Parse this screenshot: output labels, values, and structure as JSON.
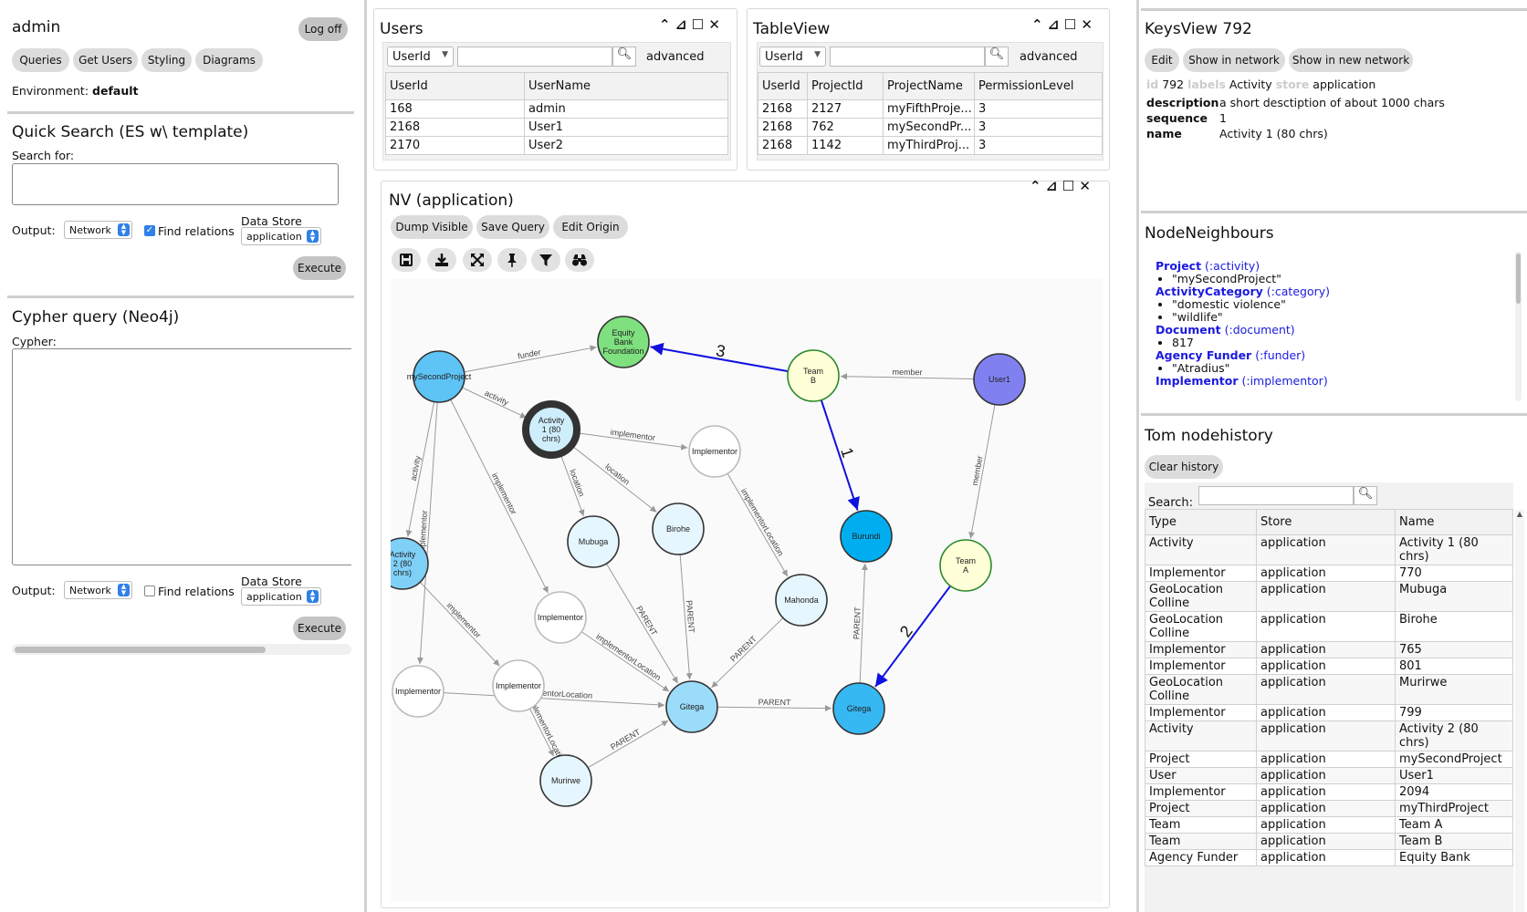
{
  "left": {
    "user": "admin",
    "logoff": "Log off",
    "nav": [
      "Queries",
      "Get Users",
      "Styling",
      "Diagrams"
    ],
    "env_label": "Environment:",
    "env_value": "default",
    "quick": {
      "title": "Quick Search (ES w\\ template)",
      "search_label": "Search for:",
      "output_label": "Output:",
      "output_value": "Network",
      "find_rel": "Find relations",
      "store_label": "Data Store",
      "store_value": "application",
      "execute": "Execute"
    },
    "cypher": {
      "title": "Cypher query (Neo4j)",
      "label": "Cypher:",
      "output_label": "Output:",
      "output_value": "Network",
      "find_rel": "Find relations",
      "store_label": "Data Store",
      "store_value": "application",
      "execute": "Execute"
    }
  },
  "users": {
    "title": "Users",
    "filter": "UserId",
    "advanced": "advanced",
    "cols": [
      "UserId",
      "UserName"
    ],
    "rows": [
      [
        "168",
        "admin"
      ],
      [
        "2168",
        "User1"
      ],
      [
        "2170",
        "User2"
      ]
    ]
  },
  "tableview": {
    "title": "TableView",
    "filter": "UserId",
    "advanced": "advanced",
    "cols": [
      "UserId",
      "ProjectId",
      "ProjectName",
      "PermissionLevel"
    ],
    "rows": [
      [
        "2168",
        "2127",
        "myFifthProje...",
        "3"
      ],
      [
        "2168",
        "762",
        "mySecondPr...",
        "3"
      ],
      [
        "2168",
        "1142",
        "myThirdProj...",
        "3"
      ]
    ]
  },
  "nv": {
    "title": "NV (application)",
    "buttons": [
      "Dump Visible",
      "Save Query",
      "Edit Origin"
    ],
    "icons": [
      "save-icon",
      "download-icon",
      "expand-icon",
      "pin-icon",
      "filter-icon",
      "binoculars-icon"
    ],
    "nodes": [
      {
        "id": "msp",
        "label": [
          "mySecondProject"
        ],
        "fill": "#5ec4f5",
        "stroke": "#333"
      },
      {
        "id": "ebf",
        "label": [
          "Equity",
          "Bank",
          "Foundation"
        ],
        "fill": "#7ee07e",
        "stroke": "#333"
      },
      {
        "id": "tb",
        "label": [
          "Team",
          "B"
        ],
        "fill": "#ffffd8",
        "stroke": "#2a8a2a"
      },
      {
        "id": "u1",
        "label": [
          "User1"
        ],
        "fill": "#8080f0",
        "stroke": "#333"
      },
      {
        "id": "a1",
        "label": [
          "Activity",
          "1 (80",
          "chrs)"
        ],
        "fill": "#cfeefc",
        "stroke": "#333"
      },
      {
        "id": "imp1",
        "label": [
          "Implementor"
        ],
        "fill": "#fff",
        "stroke": "#bbb"
      },
      {
        "id": "bur",
        "label": [
          "Burundi"
        ],
        "fill": "#00aef0",
        "stroke": "#333"
      },
      {
        "id": "mub",
        "label": [
          "Mubuga"
        ],
        "fill": "#e6f6fe",
        "stroke": "#333"
      },
      {
        "id": "bir",
        "label": [
          "Birohe"
        ],
        "fill": "#e6f6fe",
        "stroke": "#333"
      },
      {
        "id": "a2",
        "label": [
          "Activity",
          "2 (80",
          "chrs)"
        ],
        "fill": "#7fd0f7",
        "stroke": "#333"
      },
      {
        "id": "ta",
        "label": [
          "Team",
          "A"
        ],
        "fill": "#ffffd8",
        "stroke": "#2a8a2a"
      },
      {
        "id": "mah",
        "label": [
          "Mahonda"
        ],
        "fill": "#e6f6fe",
        "stroke": "#333"
      },
      {
        "id": "imp2",
        "label": [
          "Implementor"
        ],
        "fill": "#fff",
        "stroke": "#bbb"
      },
      {
        "id": "imp3",
        "label": [
          "Implementor"
        ],
        "fill": "#fff",
        "stroke": "#bbb"
      },
      {
        "id": "imp4",
        "label": [
          "Implementor"
        ],
        "fill": "#fff",
        "stroke": "#bbb"
      },
      {
        "id": "git1",
        "label": [
          "Gitega"
        ],
        "fill": "#9bdcfa",
        "stroke": "#333"
      },
      {
        "id": "git2",
        "label": [
          "Gitega"
        ],
        "fill": "#36b8f2",
        "stroke": "#333"
      },
      {
        "id": "mur",
        "label": [
          "Murirwe"
        ],
        "fill": "#e6f6fe",
        "stroke": "#333"
      }
    ],
    "edges": [
      {
        "from": "msp",
        "to": "ebf",
        "label": "funder"
      },
      {
        "from": "msp",
        "to": "a1",
        "label": "activity"
      },
      {
        "from": "msp",
        "to": "a2",
        "label": "activity"
      },
      {
        "from": "msp",
        "to": "imp2",
        "label": "implementor"
      },
      {
        "from": "msp",
        "to": "imp3",
        "label": "implementor"
      },
      {
        "from": "a1",
        "to": "imp1",
        "label": "implementor"
      },
      {
        "from": "a1",
        "to": "mub",
        "label": "location"
      },
      {
        "from": "a1",
        "to": "bir",
        "label": "location"
      },
      {
        "from": "imp1",
        "to": "mah",
        "label": "implementorLocation"
      },
      {
        "from": "u1",
        "to": "tb",
        "label": "member"
      },
      {
        "from": "u1",
        "to": "ta",
        "label": "member"
      },
      {
        "from": "tb",
        "to": "ebf",
        "label": "3",
        "blue": true
      },
      {
        "from": "tb",
        "to": "bur",
        "label": "1",
        "blue": true
      },
      {
        "from": "ta",
        "to": "git2",
        "label": "2",
        "blue": true
      },
      {
        "from": "git2",
        "to": "bur",
        "label": "PARENT"
      },
      {
        "from": "mub",
        "to": "git1",
        "label": "PARENT"
      },
      {
        "from": "bir",
        "to": "git1",
        "label": "PARENT"
      },
      {
        "from": "mah",
        "to": "git1",
        "label": "PARENT"
      },
      {
        "from": "imp2",
        "to": "git1",
        "label": "implementorLocation"
      },
      {
        "from": "imp3",
        "to": "git1",
        "label": "implementorLocation"
      },
      {
        "from": "a2",
        "to": "imp4",
        "label": "implementor"
      },
      {
        "from": "imp4",
        "to": "mur",
        "label": "implementorLocation"
      },
      {
        "from": "mur",
        "to": "git1",
        "label": "PARENT"
      },
      {
        "from": "git1",
        "to": "git2",
        "label": "PARENT"
      }
    ]
  },
  "keys": {
    "title": "KeysView 792",
    "buttons": [
      "Edit",
      "Show in network",
      "Show in new network"
    ],
    "id_key": "id",
    "id_val": "792",
    "labels_key": "labels",
    "labels_val": "Activity",
    "store_key": "store",
    "store_val": "application",
    "props": [
      [
        "description",
        "a short desctiption of about 1000 chars"
      ],
      [
        "sequence",
        "1"
      ],
      [
        "name",
        "Activity 1 (80 chrs)"
      ]
    ]
  },
  "neigh": {
    "title": "NodeNeighbours",
    "groups": [
      {
        "name": "Project",
        "type": "(:activity)",
        "items": [
          "\"mySecondProject\""
        ]
      },
      {
        "name": "ActivityCategory",
        "type": "(:category)",
        "items": [
          "\"domestic violence\"",
          "\"wildlife\""
        ]
      },
      {
        "name": "Document",
        "type": "(:document)",
        "items": [
          "817"
        ]
      },
      {
        "name": "Agency Funder",
        "type": "(:funder)",
        "items": [
          "\"Atradius\""
        ]
      },
      {
        "name": "Implementor",
        "type": "(:implementor)",
        "items": []
      }
    ]
  },
  "history": {
    "title": "Tom nodehistory",
    "clear": "Clear history",
    "search_label": "Search:",
    "cols": [
      "Type",
      "Store",
      "Name"
    ],
    "rows": [
      [
        "Activity",
        "application",
        "Activity 1 (80 chrs)"
      ],
      [
        "Implementor",
        "application",
        "770"
      ],
      [
        "GeoLocation Colline",
        "application",
        "Mubuga"
      ],
      [
        "GeoLocation Colline",
        "application",
        "Birohe"
      ],
      [
        "Implementor",
        "application",
        "765"
      ],
      [
        "Implementor",
        "application",
        "801"
      ],
      [
        "GeoLocation Colline",
        "application",
        "Murirwe"
      ],
      [
        "Implementor",
        "application",
        "799"
      ],
      [
        "Activity",
        "application",
        "Activity 2 (80 chrs)"
      ],
      [
        "Project",
        "application",
        "mySecondProject"
      ],
      [
        "User",
        "application",
        "User1"
      ],
      [
        "Implementor",
        "application",
        "2094"
      ],
      [
        "Project",
        "application",
        "myThirdProject"
      ],
      [
        "Team",
        "application",
        "Team A"
      ],
      [
        "Team",
        "application",
        "Team B"
      ],
      [
        "Agency Funder",
        "application",
        "Equity Bank"
      ]
    ]
  }
}
